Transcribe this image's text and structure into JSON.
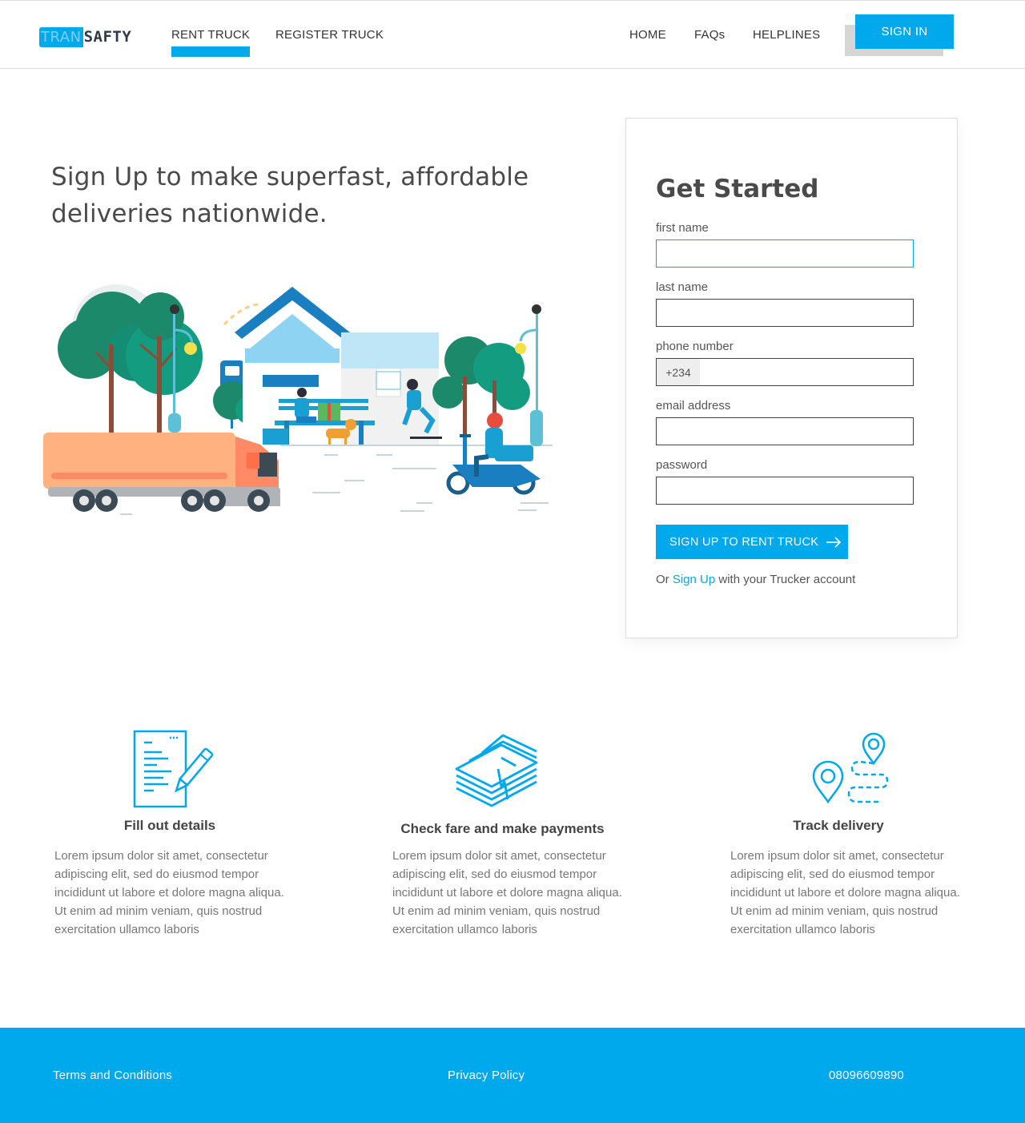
{
  "brand": {
    "part1": "TRAN",
    "part2": "SAFTY"
  },
  "nav": {
    "left": [
      {
        "label": "RENT TRUCK"
      },
      {
        "label": "REGISTER TRUCK"
      }
    ],
    "right": [
      {
        "label": "HOME"
      },
      {
        "label": "FAQs"
      },
      {
        "label": "HELPLINES"
      }
    ],
    "signin": "SIGN IN"
  },
  "hero": {
    "headline_line1": "Sign Up to make superfast, affordable",
    "headline_line2": "deliveries nationwide."
  },
  "form": {
    "title": "Get Started",
    "first_name_label": "first name",
    "last_name_label": "last name",
    "phone_label": "phone number",
    "phone_prefix": "+234",
    "email_label": "email address",
    "password_label": "password",
    "submit_label": "SIGN UP TO RENT TRUCK",
    "alt_prefix": "Or",
    "alt_link": "Sign Up",
    "alt_suffix": "with your Trucker account"
  },
  "features": [
    {
      "icon": "document-pen-icon",
      "title": "Fill out details",
      "text": "Lorem ipsum dolor sit amet, consectetur adipiscing elit, sed do eiusmod tempor incididunt ut labore et dolore magna aliqua. Ut enim ad minim veniam, quis nostrud exercitation ullamco laboris"
    },
    {
      "icon": "money-stack-icon",
      "title": "Check fare and make payments",
      "text": "Lorem ipsum dolor sit amet, consectetur adipiscing elit, sed do eiusmod tempor incididunt ut labore et dolore magna aliqua. Ut enim ad minim veniam, quis nostrud exercitation ullamco laboris"
    },
    {
      "icon": "route-pin-icon",
      "title": "Track delivery",
      "text": "Lorem ipsum dolor sit amet, consectetur adipiscing elit, sed do eiusmod tempor incididunt ut labore et dolore magna aliqua. Ut enim ad minim veniam, quis nostrud exercitation ullamco laboris"
    }
  ],
  "footer": {
    "terms": "Terms and Conditions",
    "privacy": "Privacy Policy",
    "phone": "08096609890"
  },
  "colors": {
    "accent": "#00a8ec",
    "text": "#444444",
    "muted": "#777777"
  }
}
